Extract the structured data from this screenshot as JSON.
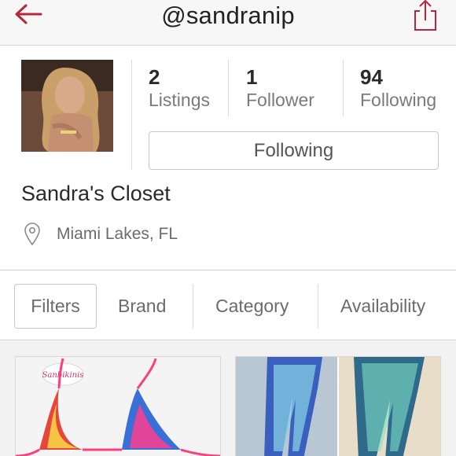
{
  "header": {
    "username": "@sandranip",
    "accent_color": "#b5283c",
    "back_icon": "back-arrow-icon",
    "share_icon": "share-icon"
  },
  "profile": {
    "stats": [
      {
        "value": "2",
        "label": "Listings"
      },
      {
        "value": "1",
        "label": "Follower"
      },
      {
        "value": "94",
        "label": "Following"
      }
    ],
    "follow_button": "Following",
    "closet_name": "Sandra's Closet",
    "location": "Miami Lakes, FL",
    "location_icon": "map-pin-icon"
  },
  "filters": {
    "items": [
      "Filters",
      "Brand",
      "Category",
      "Availability"
    ]
  },
  "listings": [
    {
      "name": "bikini-top-listing",
      "badge": "Sanbikinis"
    },
    {
      "name": "leggings-listing"
    }
  ]
}
